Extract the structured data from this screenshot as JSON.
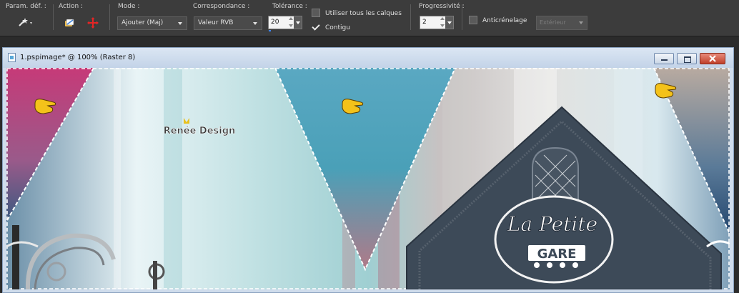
{
  "toolbar": {
    "preset_label": "Param. déf. :",
    "action_label": "Action :",
    "mode": {
      "label": "Mode :",
      "value": "Ajouter (Maj)"
    },
    "match": {
      "label": "Correspondance :",
      "value": "Valeur RVB"
    },
    "tolerance": {
      "label": "Tolérance :",
      "value": "20"
    },
    "use_all_layers": {
      "label": "Utiliser tous les calques",
      "checked": false
    },
    "contiguous": {
      "label": "Contigu",
      "checked": true
    },
    "feather": {
      "label": "Progressivité :",
      "value": "2"
    },
    "antialias": {
      "label": "Anticrénelage",
      "checked": false
    },
    "antialias_mode": {
      "value": "Extérieur"
    }
  },
  "window": {
    "title": "1.pspimage* @ 100% (Raster 8)"
  },
  "canvas": {
    "watermark": "Renée Design",
    "logo_line1": "La Petite",
    "logo_line2": "GARE"
  },
  "colors": {
    "panel": "#3c3c3c",
    "window_frame": "#cfdcec",
    "roof": "#3d4a58",
    "close_red": "#c0402a"
  }
}
